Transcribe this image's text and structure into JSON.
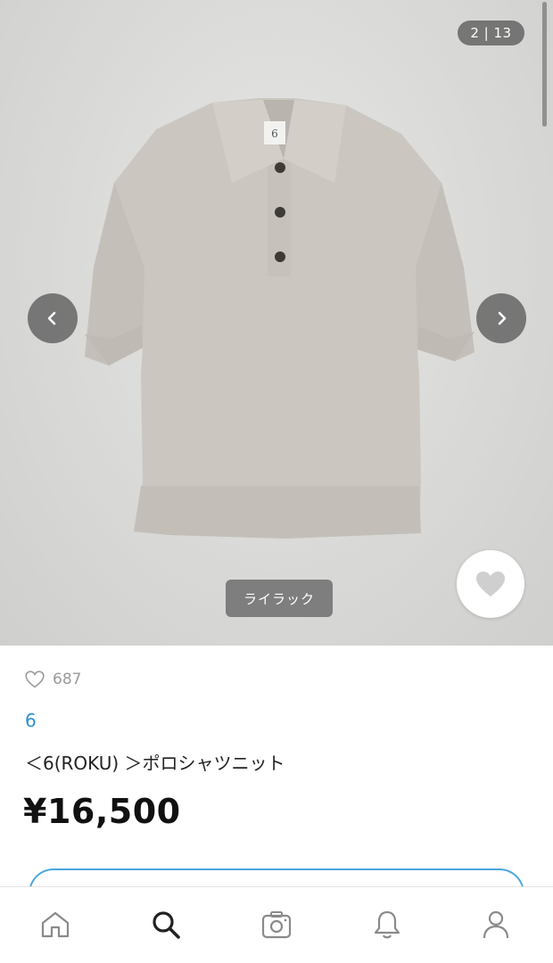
{
  "gallery": {
    "counter": "2 | 13",
    "color_label": "ライラック",
    "image_alt": "polo-knit-shirt-photo"
  },
  "product": {
    "like_count": "687",
    "brand": "6",
    "title": "＜6(ROKU) ＞ポロシャツニット",
    "price": "¥16,500"
  },
  "icons": {
    "prev": "chevron-left-icon",
    "next": "chevron-right-icon",
    "like_fab": "heart-icon",
    "like_small": "heart-outline-icon",
    "tabs": [
      "home-icon",
      "search-icon",
      "camera-icon",
      "bell-icon",
      "person-icon"
    ]
  },
  "colors": {
    "brand_blue": "#2a8fd6",
    "price": "#111111",
    "overlay_pill": "#505050",
    "shirt": "#c9c5be"
  }
}
